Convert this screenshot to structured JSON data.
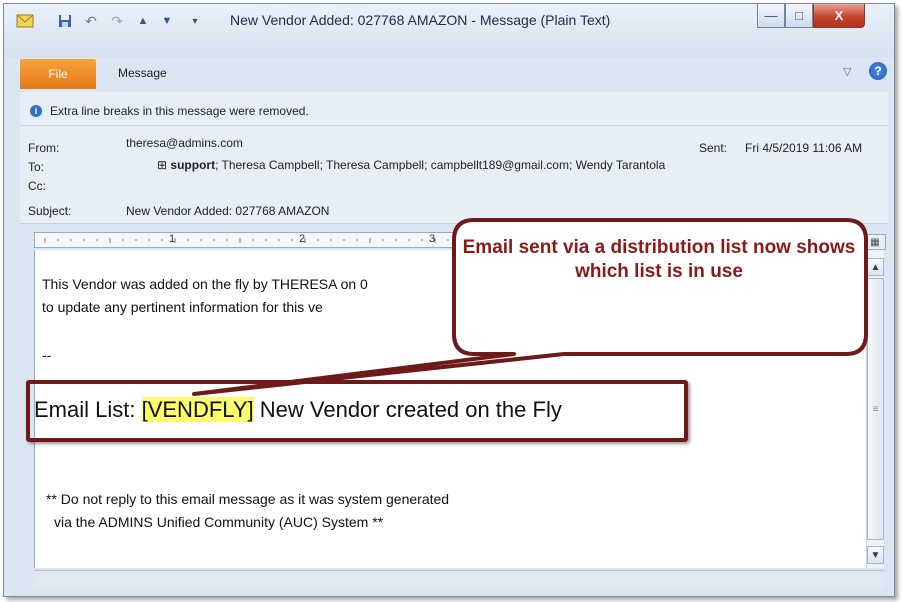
{
  "window": {
    "title": "New Vendor Added: 027768 AMAZON  -  Message (Plain Text)",
    "minimize_glyph": "—",
    "maximize_glyph": "□",
    "close_glyph": "X"
  },
  "ribbon": {
    "tabs": [
      {
        "label": "File",
        "active": true
      },
      {
        "label": "Message",
        "active": false
      }
    ],
    "expand_glyph": "▽",
    "help_glyph": "?"
  },
  "infobar": {
    "icon_glyph": "i",
    "text": "Extra line breaks in this message were removed."
  },
  "header": {
    "from_label": "From:",
    "from_value": "theresa@admins.com",
    "sent_label": "Sent:",
    "sent_value": "Fri 4/5/2019 11:06 AM",
    "to_label": "To:",
    "to_expand_glyph": "⊞",
    "to_group": "support",
    "to_rest": "; Theresa Campbell; Theresa Campbell; campbellt189@gmail.com; Wendy Tarantola",
    "cc_label": "Cc:",
    "subject_label": "Subject:",
    "subject_value": "New Vendor Added: 027768 AMAZON"
  },
  "ruler": {
    "marks": [
      "1",
      "2",
      "3"
    ]
  },
  "body": {
    "line1": "This Vendor was added on the fly by THERESA on 0",
    "line2": "to update any pertinent information for this ve",
    "separator": "--",
    "email_list_label": "Email List: ",
    "email_list_tag": "[VENDFLY]",
    "email_list_desc": " New Vendor created on the Fly",
    "footer_line1": "** Do not reply to this email message as it was system generated",
    "footer_line2": "via the ADMINS Unified Community (AUC) System **"
  },
  "callout": {
    "text": "Email sent via a distribution list now shows which list is in use"
  },
  "icons": {
    "envelope": "envelope-icon",
    "save": "save-icon",
    "undo": "undo-icon",
    "redo": "redo-icon",
    "up": "arrow-up-icon",
    "down": "arrow-down-icon",
    "customize": "customize-qat-icon"
  },
  "colors": {
    "file_tab": "#e5791a",
    "callout_border": "#6e1a1a",
    "callout_text": "#8a1a1a",
    "highlight": "#fcfc6c"
  }
}
